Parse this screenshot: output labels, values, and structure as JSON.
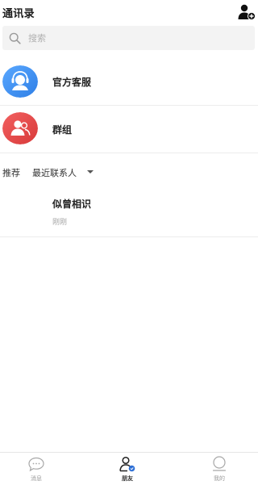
{
  "header": {
    "title": "通讯录",
    "add_contact_icon": "add-user-icon"
  },
  "search": {
    "placeholder": "搜索",
    "value": "",
    "icon": "search-icon"
  },
  "entries": [
    {
      "label": "官方客服",
      "icon": "headset-agent-icon",
      "color": "#3b8ff2"
    },
    {
      "label": "群组",
      "icon": "group-users-icon",
      "color": "#e64545"
    }
  ],
  "filter": {
    "recommend_label": "推荐",
    "selected_option": "最近联系人",
    "dropdown_icon": "caret-down-icon"
  },
  "contacts": [
    {
      "name": "似曾相识",
      "time": "刚刚"
    }
  ],
  "tabbar": {
    "tabs": [
      {
        "label": "消息",
        "icon": "chat-bubble-icon",
        "active": false
      },
      {
        "label": "朋友",
        "icon": "friends-icon",
        "active": true
      },
      {
        "label": "我的",
        "icon": "profile-icon",
        "active": false
      }
    ]
  },
  "colors": {
    "accent_blue": "#3b8ff2",
    "accent_red": "#e64545",
    "text_primary": "#222222",
    "text_muted": "#a6a6a6",
    "search_bg": "#f3f3f3"
  }
}
